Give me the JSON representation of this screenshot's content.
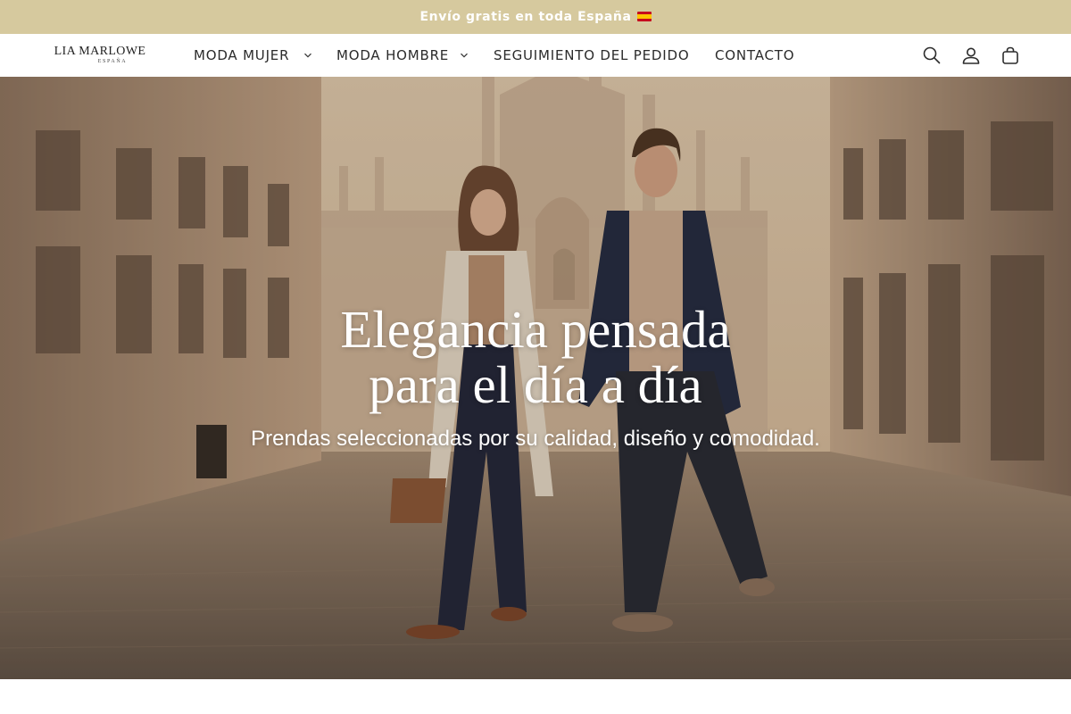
{
  "announcement": {
    "text": "Envío gratis en toda España",
    "flag_icon": "spain-flag-icon"
  },
  "brand": {
    "logo_main": "LIA MARLOWE",
    "logo_sub": "ESPAÑA"
  },
  "nav": {
    "items": [
      {
        "label": "MODA MUJER",
        "has_dropdown": true
      },
      {
        "label": "MODA HOMBRE",
        "has_dropdown": true
      },
      {
        "label": "SEGUIMIENTO DEL PEDIDO",
        "has_dropdown": false
      },
      {
        "label": "CONTACTO",
        "has_dropdown": false
      }
    ]
  },
  "header_icons": [
    "search-icon",
    "account-icon",
    "cart-icon"
  ],
  "hero": {
    "title_line1": "Elegancia pensada",
    "title_line2": "para el día a día",
    "subtitle": "Prendas seleccionadas por su calidad, diseño y comodidad."
  },
  "colors": {
    "announcement_bg": "#d6c99e",
    "header_bg": "#ffffff",
    "text": "#2b2b2b"
  }
}
